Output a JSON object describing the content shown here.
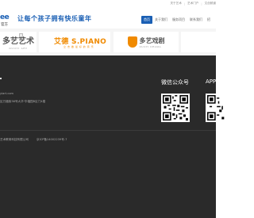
{
  "topbar": {
    "links": [
      "关于艺术",
      "|",
      "艺术门户",
      "|",
      "文创频道"
    ]
  },
  "header": {
    "logo_letters": "ee",
    "logo_sub": "官方",
    "slogan": "让每个孩子拥有快乐童年",
    "nav": [
      "首页",
      "关于我们",
      "服务项目",
      "联系我们",
      "招"
    ]
  },
  "banner": {
    "card1": {
      "brand": "多艺艺术",
      "en": "DUOYI ART"
    },
    "card2": {
      "brand": "艾德 S.PIANO",
      "sub": "立 志 做 最 好 的 音 乐"
    },
    "card3": {
      "brand": "多艺戏剧",
      "en": "DUOYI DRAMA"
    },
    "card4": {
      "brand": ""
    }
  },
  "footer": {
    "line1": "",
    "line2": "yiart.com",
    "line3": "区万福街36号大华·华福园B区门4楼",
    "wechat_title": "微信公众号",
    "app_title": "APP",
    "copyright": "艺术教育科技有限公司",
    "icp": "京ICP备14002239号-7"
  },
  "colors": {
    "brand_blue": "#1a5fb4",
    "brand_orange": "#f08a00",
    "footer_bg": "#2a2a2a"
  }
}
